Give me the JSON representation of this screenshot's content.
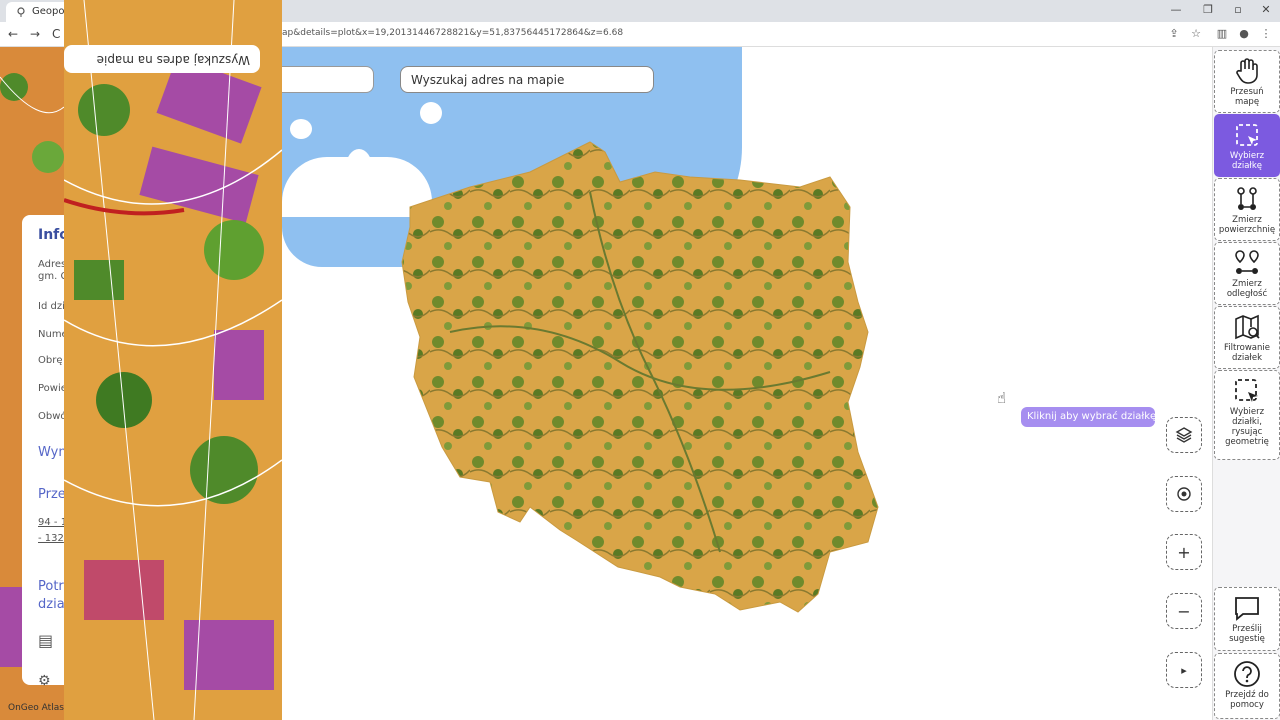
{
  "browser": {
    "tab_title": "Geoporta",
    "url": "ap&details=plot&x=19,20131446728821&y=51,83756445172864&z=6.68",
    "nav_back": "←",
    "nav_forward": "→",
    "nav_reload": "C"
  },
  "map": {
    "search_placeholder": "Wyszukaj adres na mapie",
    "mirrored_search": "Wyszukaj adres na mapie",
    "tooltip": "Kliknij aby wybrać działkę"
  },
  "left_panel": {
    "info_title": "Info",
    "rows": [
      "Adres",
      "gm. C",
      "Id dzi",
      "Nume",
      "Obrę",
      "Powie",
      "Obwó"
    ],
    "section_wym": "Wym",
    "section_prze": "Prze",
    "link_94": "94 - 1",
    "link_132": "- 132",
    "section_potr": "Potr",
    "section_dzia": "dzia",
    "footer": "OnGeo Atlas"
  },
  "map_controls": {
    "layers_icon": "layers-icon",
    "locate_icon": "locate-icon",
    "zoom_in": "+",
    "zoom_out": "−",
    "expand": "▸"
  },
  "sidebar": {
    "tools": [
      {
        "label": "Przesuń mapę",
        "icon": "hand-icon"
      },
      {
        "label": "Wybierz działkę",
        "icon": "select-plot-icon"
      },
      {
        "label": "Zmierz powierzchnię",
        "icon": "measure-area-icon"
      },
      {
        "label": "Zmierz odległość",
        "icon": "measure-distance-icon"
      },
      {
        "label": "Filtrowanie działek",
        "icon": "filter-map-icon"
      },
      {
        "label": "Wybierz działki, rysując geometrię",
        "icon": "draw-select-icon"
      }
    ],
    "bottom": [
      {
        "label": "Prześlij sugestię",
        "icon": "chat-icon"
      },
      {
        "label": "Przejdź do pomocy",
        "icon": "help-icon"
      }
    ]
  },
  "colors": {
    "accent": "#7c5ae0",
    "sea": "#8fc0f0",
    "land": "#d9a548",
    "forest": "#5a7a24"
  }
}
